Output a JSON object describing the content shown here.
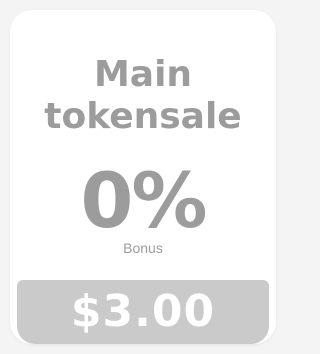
{
  "card": {
    "title_line1": "Main",
    "title_line2": "tokensale",
    "bonus_value": "0%",
    "bonus_label": "Bonus",
    "price": "$3.00"
  },
  "colors": {
    "background": "#f4f4f4",
    "card": "#ffffff",
    "text": "#9c9c9c",
    "price_bar": "#cacaca",
    "price_text": "#ffffff"
  }
}
